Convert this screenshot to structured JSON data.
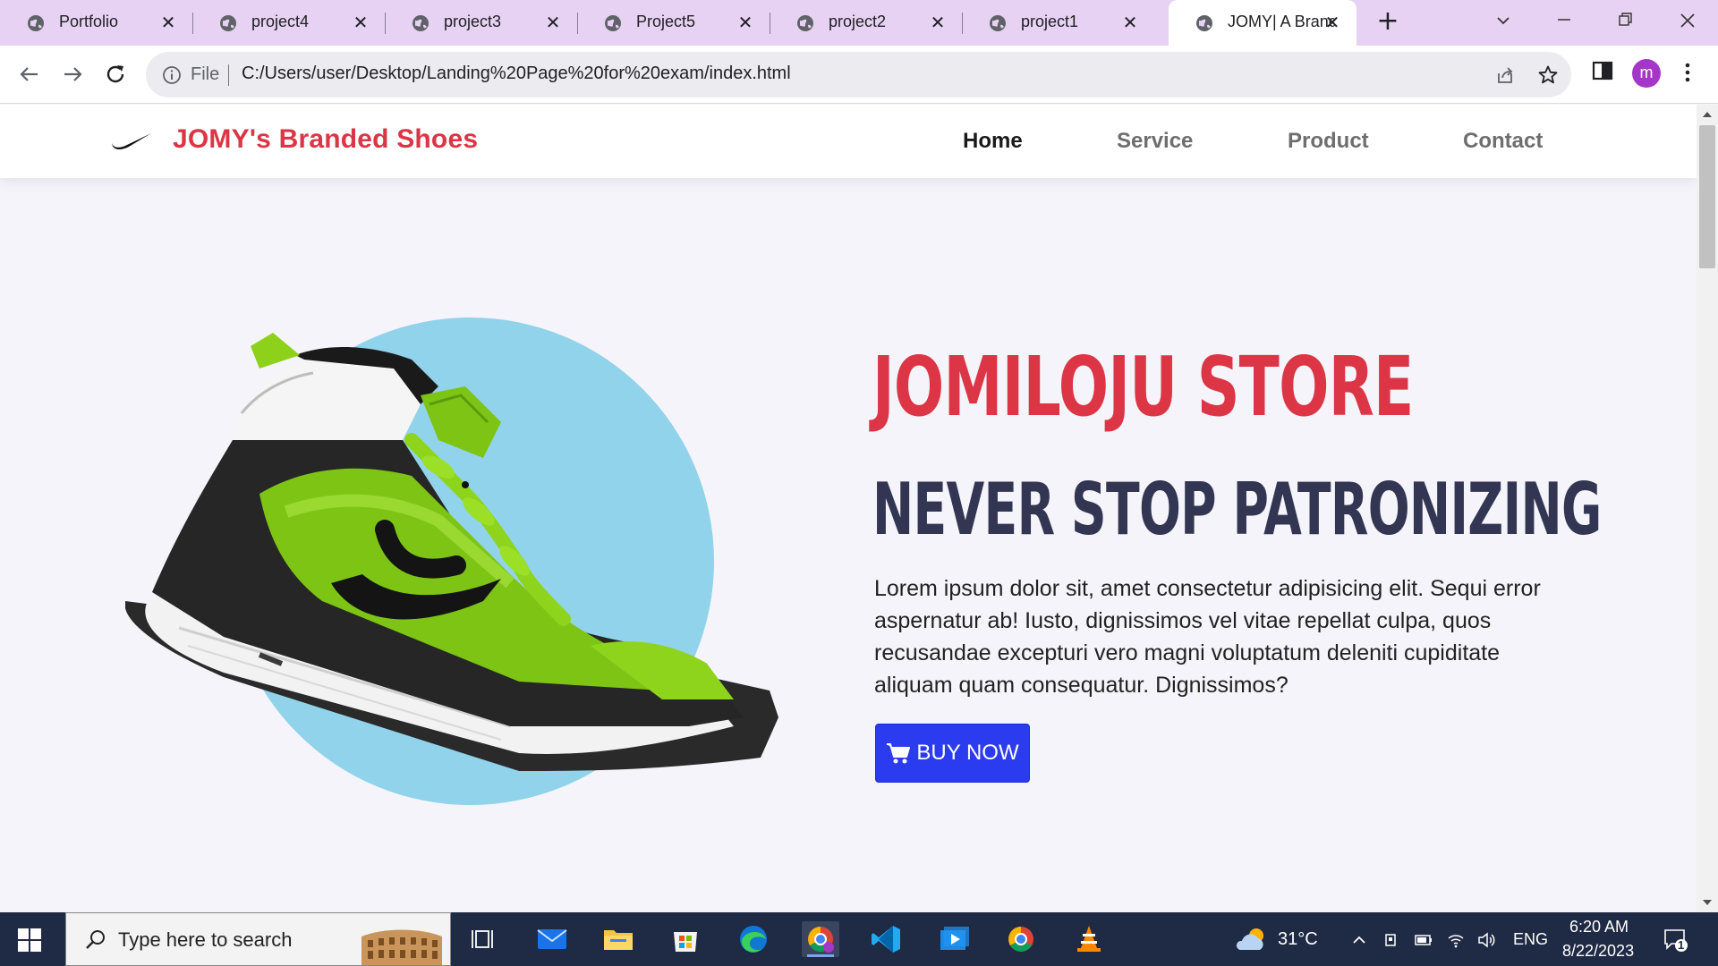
{
  "browser": {
    "tabs": [
      {
        "title": "Portfolio",
        "active": false
      },
      {
        "title": "project4",
        "active": false
      },
      {
        "title": "project3",
        "active": false
      },
      {
        "title": "Project5",
        "active": false
      },
      {
        "title": "project2",
        "active": false
      },
      {
        "title": "project1",
        "active": false
      },
      {
        "title": "JOMY| A Brand",
        "active": true
      }
    ],
    "new_tab_glyph": "+",
    "close_glyph": "✕",
    "scheme_label": "File",
    "url": "C:/Users/user/Desktop/Landing%20Page%20for%20exam/index.html",
    "profile_initial": "m",
    "tab_strip_color": "#e7d2f3",
    "profile_color": "#a437c8"
  },
  "site": {
    "logo_icon": "nike-swoosh-icon",
    "brand": "JOMY's Branded Shoes",
    "nav": [
      {
        "label": "Home",
        "current": true
      },
      {
        "label": "Service",
        "current": false
      },
      {
        "label": "Product",
        "current": false
      },
      {
        "label": "Contact",
        "current": false
      }
    ],
    "hero": {
      "title": "JOMILOJU STORE",
      "subtitle": "NEVER STOP PATRONIZING",
      "text": "Lorem ipsum dolor sit, amet consectetur adipisicing elit. Sequi error aspernatur ab! Iusto, dignissimos vel vitae repellat culpa, quos recusandae excepturi vero magni voluptatum deleniti cupiditate aliquam quam consequatur. Dignissimos?",
      "button_label": "BUY NOW",
      "button_icon": "shopping-cart-icon",
      "image": "green-sneaker"
    },
    "colors": {
      "accent_red": "#dc3545",
      "title_navy": "#333652",
      "button_blue": "#2b3cf0",
      "circle_blue": "#91d3ea"
    }
  },
  "taskbar": {
    "search_placeholder": "Type here to search",
    "weather": "31°C",
    "language": "ENG",
    "time": "6:20 AM",
    "date": "8/22/2023",
    "notification_count": "1"
  }
}
